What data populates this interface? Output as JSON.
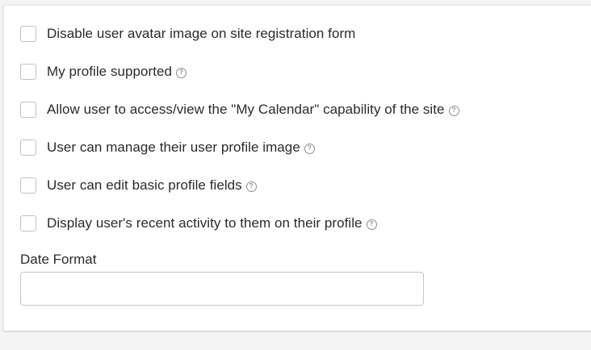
{
  "options": [
    {
      "label": "Disable user avatar image on site registration form",
      "checked": false,
      "has_help": false
    },
    {
      "label": "My profile supported",
      "checked": false,
      "has_help": true
    },
    {
      "label": "Allow user to access/view the \"My Calendar\" capability of the site",
      "checked": false,
      "has_help": true
    },
    {
      "label": "User can manage their user profile image",
      "checked": false,
      "has_help": true
    },
    {
      "label": "User can edit basic profile fields",
      "checked": false,
      "has_help": true
    },
    {
      "label": "Display user's recent activity to them on their profile",
      "checked": false,
      "has_help": true
    }
  ],
  "help_icon_glyph": "?",
  "date_format": {
    "label": "Date Format",
    "value": "",
    "placeholder": ""
  }
}
